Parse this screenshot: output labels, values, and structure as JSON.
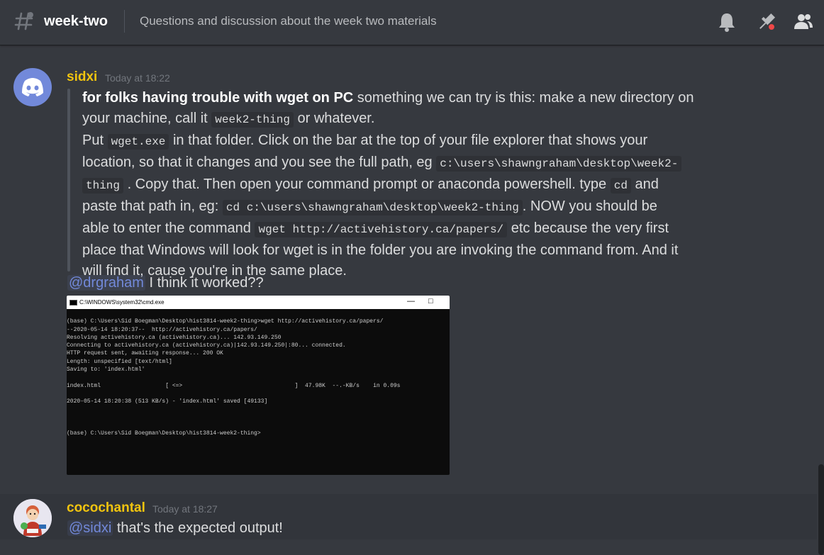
{
  "header": {
    "channel_name": "week-two",
    "topic": "Questions and discussion about the week two materials",
    "icons": [
      "hash-icon",
      "bell-icon",
      "pin-icon",
      "members-icon"
    ]
  },
  "messages": [
    {
      "username": "sidxi",
      "timestamp": "Today at 18:22",
      "quote": {
        "line1_bold": "for folks having trouble with wget on PC",
        "line1_rest": " something we can try is this: make a new directory on",
        "line2_a": "your machine, call it ",
        "line2_code": "week2-thing",
        "line2_b": " or whatever.",
        "line3_a": "Put ",
        "line3_code": "wget.exe",
        "line3_b": " in that folder. Click on the bar at the top of your file explorer that shows your",
        "line4_a": "location, so that it changes and you see the full path, eg ",
        "line4_code": "c:\\users\\shawngraham\\desktop\\week2-",
        "line5_code": "thing",
        "line5_a": " . Copy that. Then open your command prompt or anaconda powershell. type ",
        "line5_code2": "cd",
        "line5_b": " and",
        "line6_a": "paste that path in, eg: ",
        "line6_code": "cd c:\\users\\shawngraham\\desktop\\week2-thing",
        "line6_b": ". NOW you should be",
        "line7_a": "able to enter the command ",
        "line7_code": "wget http://activehistory.ca/papers/",
        "line7_b": " etc because the very first",
        "line8": "place that Windows will look for wget is in the folder you are invoking the command from. And it",
        "line9": "will find it, cause you're in the same place."
      },
      "followup_mention": "@drgraham",
      "followup_text": " I think it worked??",
      "attachment": {
        "window_title": "C:\\WINDOWS\\system32\\cmd.exe",
        "lines": [
          "",
          "(base) C:\\Users\\Sid Boegman\\Desktop\\hist3814-week2-thing>wget http://activehistory.ca/papers/",
          "--2020-05-14 18:20:37--  http://activehistory.ca/papers/",
          "Resolving activehistory.ca (activehistory.ca)... 142.93.149.250",
          "Connecting to activehistory.ca (activehistory.ca)|142.93.149.250|:80... connected.",
          "HTTP request sent, awaiting response... 200 OK",
          "Length: unspecified [text/html]",
          "Saving to: 'index.html'",
          "",
          "index.html                   [ <=>                                 ]  47.98K  --.-KB/s    in 0.09s",
          "",
          "2020-05-14 18:20:38 (513 KB/s) - 'index.html' saved [49133]",
          "",
          "",
          "",
          "(base) C:\\Users\\Sid Boegman\\Desktop\\hist3814-week2-thing>"
        ]
      }
    },
    {
      "username": "cocochantal",
      "timestamp": "Today at 18:27",
      "mention": "@sidxi",
      "text": " that's the expected output!"
    }
  ],
  "colors": {
    "background": "#36393f",
    "username": "#f1c40f",
    "mention": "#7289da",
    "discord_blurple": "#7289da",
    "notification_dot": "#f04747"
  }
}
